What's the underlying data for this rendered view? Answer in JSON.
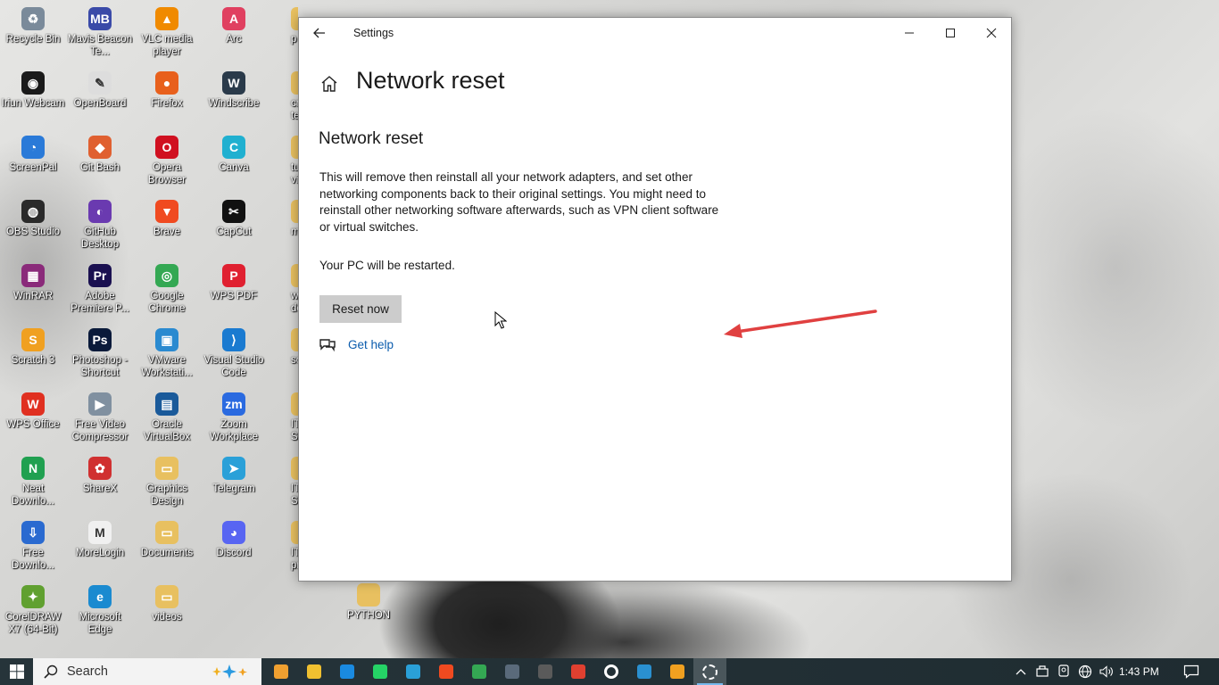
{
  "desktop": {
    "icons": [
      {
        "label": "Recycle Bin",
        "color": "#7a8a9a",
        "glyph": "♻"
      },
      {
        "label": "Mavis Beacon Te...",
        "color": "#3a4aa8",
        "glyph": "MB"
      },
      {
        "label": "VLC media player",
        "color": "#f08a00",
        "glyph": "▲"
      },
      {
        "label": "Arc",
        "color": "#e04060",
        "glyph": "A"
      },
      {
        "label": "Iriun Webcam",
        "color": "#1a1a1a",
        "glyph": "◉"
      },
      {
        "label": "OpenBoard",
        "color": "#dddddd",
        "glyph": "✎"
      },
      {
        "label": "Firefox",
        "color": "#e8601c",
        "glyph": "●"
      },
      {
        "label": "Windscribe",
        "color": "#2a3a4a",
        "glyph": "W"
      },
      {
        "label": "ScreenPal",
        "color": "#2a7ad8",
        "glyph": "◔"
      },
      {
        "label": "Git Bash",
        "color": "#e06030",
        "glyph": "◆"
      },
      {
        "label": "Opera Browser",
        "color": "#d01020",
        "glyph": "O"
      },
      {
        "label": "Canva",
        "color": "#20b0d0",
        "glyph": "C"
      },
      {
        "label": "OBS Studio",
        "color": "#2a2a2a",
        "glyph": "◍"
      },
      {
        "label": "GitHub Desktop",
        "color": "#6a3ab0",
        "glyph": "◐"
      },
      {
        "label": "Brave",
        "color": "#f04a20",
        "glyph": "▼"
      },
      {
        "label": "CapCut",
        "color": "#111111",
        "glyph": "✂"
      },
      {
        "label": "WinRAR",
        "color": "#8a2a7a",
        "glyph": "▦"
      },
      {
        "label": "Adobe Premiere P...",
        "color": "#1a1050",
        "glyph": "Pr"
      },
      {
        "label": "Google Chrome",
        "color": "#34a853",
        "glyph": "◎"
      },
      {
        "label": "WPS PDF",
        "color": "#e02030",
        "glyph": "P"
      },
      {
        "label": "Scratch 3",
        "color": "#f0a020",
        "glyph": "S"
      },
      {
        "label": "Photoshop - Shortcut",
        "color": "#0a1a3a",
        "glyph": "Ps"
      },
      {
        "label": "VMware Workstati...",
        "color": "#2a8ad0",
        "glyph": "▣"
      },
      {
        "label": "Visual Studio Code",
        "color": "#1a7ad0",
        "glyph": "⟩"
      },
      {
        "label": "WPS Office",
        "color": "#e03020",
        "glyph": "W"
      },
      {
        "label": "Free Video Compressor",
        "color": "#8090a0",
        "glyph": "▶"
      },
      {
        "label": "Oracle VirtualBox",
        "color": "#1a5a9a",
        "glyph": "▤"
      },
      {
        "label": "Zoom Workplace",
        "color": "#2a6ae0",
        "glyph": "zm"
      },
      {
        "label": "Neat Downlo...",
        "color": "#20a050",
        "glyph": "N"
      },
      {
        "label": "ShareX",
        "color": "#d03030",
        "glyph": "✿"
      },
      {
        "label": "Graphics Design",
        "color": "#e8c060",
        "glyph": "▭"
      },
      {
        "label": "Telegram",
        "color": "#2aa0d8",
        "glyph": "➤"
      },
      {
        "label": "Free Downlo...",
        "color": "#2a6ad0",
        "glyph": "⇩"
      },
      {
        "label": "MoreLogin",
        "color": "#f0f0f0",
        "glyph": "M"
      },
      {
        "label": "Documents",
        "color": "#e8c060",
        "glyph": "▭"
      },
      {
        "label": "Discord",
        "color": "#5865f2",
        "glyph": "◕"
      },
      {
        "label": "CorelDRAW X7 (64-Bit)",
        "color": "#60a030",
        "glyph": "✦"
      },
      {
        "label": "Microsoft Edge",
        "color": "#1a8ad0",
        "glyph": "e"
      },
      {
        "label": "videos",
        "color": "#e8c060",
        "glyph": "▭"
      }
    ],
    "partial_icons": [
      "p",
      "cr teac",
      "tut vid",
      "mo",
      "w devlo",
      "soft",
      "IT Su",
      "IT SU",
      "IT pr",
      "PYTHON"
    ]
  },
  "window": {
    "title": "Settings",
    "page_title": "Network reset",
    "section_title": "Network reset",
    "description": "This will remove then reinstall all your network adapters, and set other networking components back to their original settings. You might need to reinstall other networking software afterwards, such as VPN client software or virtual switches.",
    "restart_note": "Your PC will be restarted.",
    "reset_button": "Reset now",
    "help_link": "Get help"
  },
  "taskbar": {
    "search_placeholder": "Search",
    "apps": [
      {
        "name": "gem-app-icon",
        "color": "#f0a030"
      },
      {
        "name": "file-explorer-icon",
        "color": "#f0c030"
      },
      {
        "name": "vscode-icon",
        "color": "#1a8ae0"
      },
      {
        "name": "whatsapp-icon",
        "color": "#25d366"
      },
      {
        "name": "telegram-icon",
        "color": "#2aa0d8"
      },
      {
        "name": "brave-icon",
        "color": "#f04a20"
      },
      {
        "name": "chrome-icon",
        "color": "#34a853"
      },
      {
        "name": "windscribe-icon",
        "color": "#5a6a7a"
      },
      {
        "name": "obs-icon",
        "color": "#5a5a5a"
      },
      {
        "name": "chrome-profile-icon",
        "color": "#e04030"
      },
      {
        "name": "iriun-icon",
        "color": "#ffffff"
      },
      {
        "name": "virtualbox-icon",
        "color": "#2a90d0"
      },
      {
        "name": "vmware-icon",
        "color": "#f0a020"
      },
      {
        "name": "settings-icon",
        "color": "#ffffff"
      }
    ],
    "time": "1:43 PM"
  }
}
